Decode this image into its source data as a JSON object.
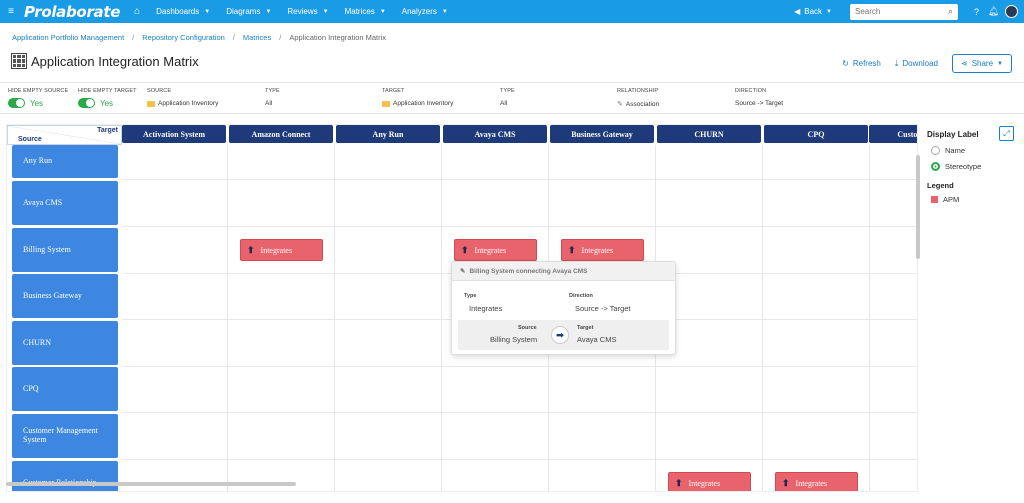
{
  "nav": {
    "brand": "Prolaborate",
    "menu": [
      "Dashboards",
      "Diagrams",
      "Reviews",
      "Matrices",
      "Analyzers"
    ],
    "back": "Back",
    "search_placeholder": "Search"
  },
  "breadcrumb": {
    "items": [
      "Application Portfolio Management",
      "Repository Configuration",
      "Matrices"
    ],
    "current": "Application Integration Matrix"
  },
  "page": {
    "title": "Application Integration Matrix",
    "refresh": "Refresh",
    "download": "Download",
    "share": "Share"
  },
  "filters": {
    "hide_source": {
      "label": "HIDE EMPTY SOURCE",
      "value": "Yes"
    },
    "hide_target": {
      "label": "HIDE EMPTY TARGET",
      "value": "Yes"
    },
    "source": {
      "label": "SOURCE",
      "value": "Application Inventory"
    },
    "source_type": {
      "label": "TYPE",
      "value": "All"
    },
    "target": {
      "label": "TARGET",
      "value": "Application Inventory"
    },
    "target_type": {
      "label": "TYPE",
      "value": "All"
    },
    "relationship": {
      "label": "RELATIONSHIP",
      "value": "Association"
    },
    "direction": {
      "label": "DIRECTION",
      "value": "Source -> Target"
    }
  },
  "matrix": {
    "corner_target": "Target",
    "corner_source": "Source",
    "columns": [
      "Activation System",
      "Amazon Connect",
      "Any Run",
      "Avaya CMS",
      "Business Gateway",
      "CHURN",
      "CPQ",
      "Customer Ma"
    ],
    "rows": [
      "Any Run",
      "Avaya CMS",
      "Billing System",
      "Business Gateway",
      "CHURN",
      "CPQ",
      "Customer Management System",
      "Customer Relationship"
    ],
    "cell_label": "Integrates",
    "cells": [
      {
        "row": "Billing System",
        "column": "Amazon Connect"
      },
      {
        "row": "Billing System",
        "column": "Avaya CMS"
      },
      {
        "row": "Billing System",
        "column": "Business Gateway"
      },
      {
        "row": "Customer Relationship",
        "column": "CHURN"
      },
      {
        "row": "Customer Relationship",
        "column": "CPQ"
      }
    ]
  },
  "popup": {
    "title": "Billing System connecting Avaya CMS",
    "type_label": "Type",
    "type_value": "Integrates",
    "direction_label": "Direction",
    "direction_value": "Source -> Target",
    "source_label": "Source",
    "source_value": "Billing System",
    "target_label": "Target",
    "target_value": "Avaya CMS"
  },
  "panel": {
    "title": "Display Label",
    "options": [
      "Name",
      "Stereotype"
    ],
    "selected": "Stereotype",
    "legend_title": "Legend",
    "legend_items": [
      {
        "label": "APM",
        "color": "#e8636b"
      }
    ]
  },
  "colors": {
    "brand": "#1a9be6",
    "header": "#1e3a7a",
    "row": "#3d87e0",
    "chip": "#e8636b",
    "toggle": "#2aa84a"
  }
}
